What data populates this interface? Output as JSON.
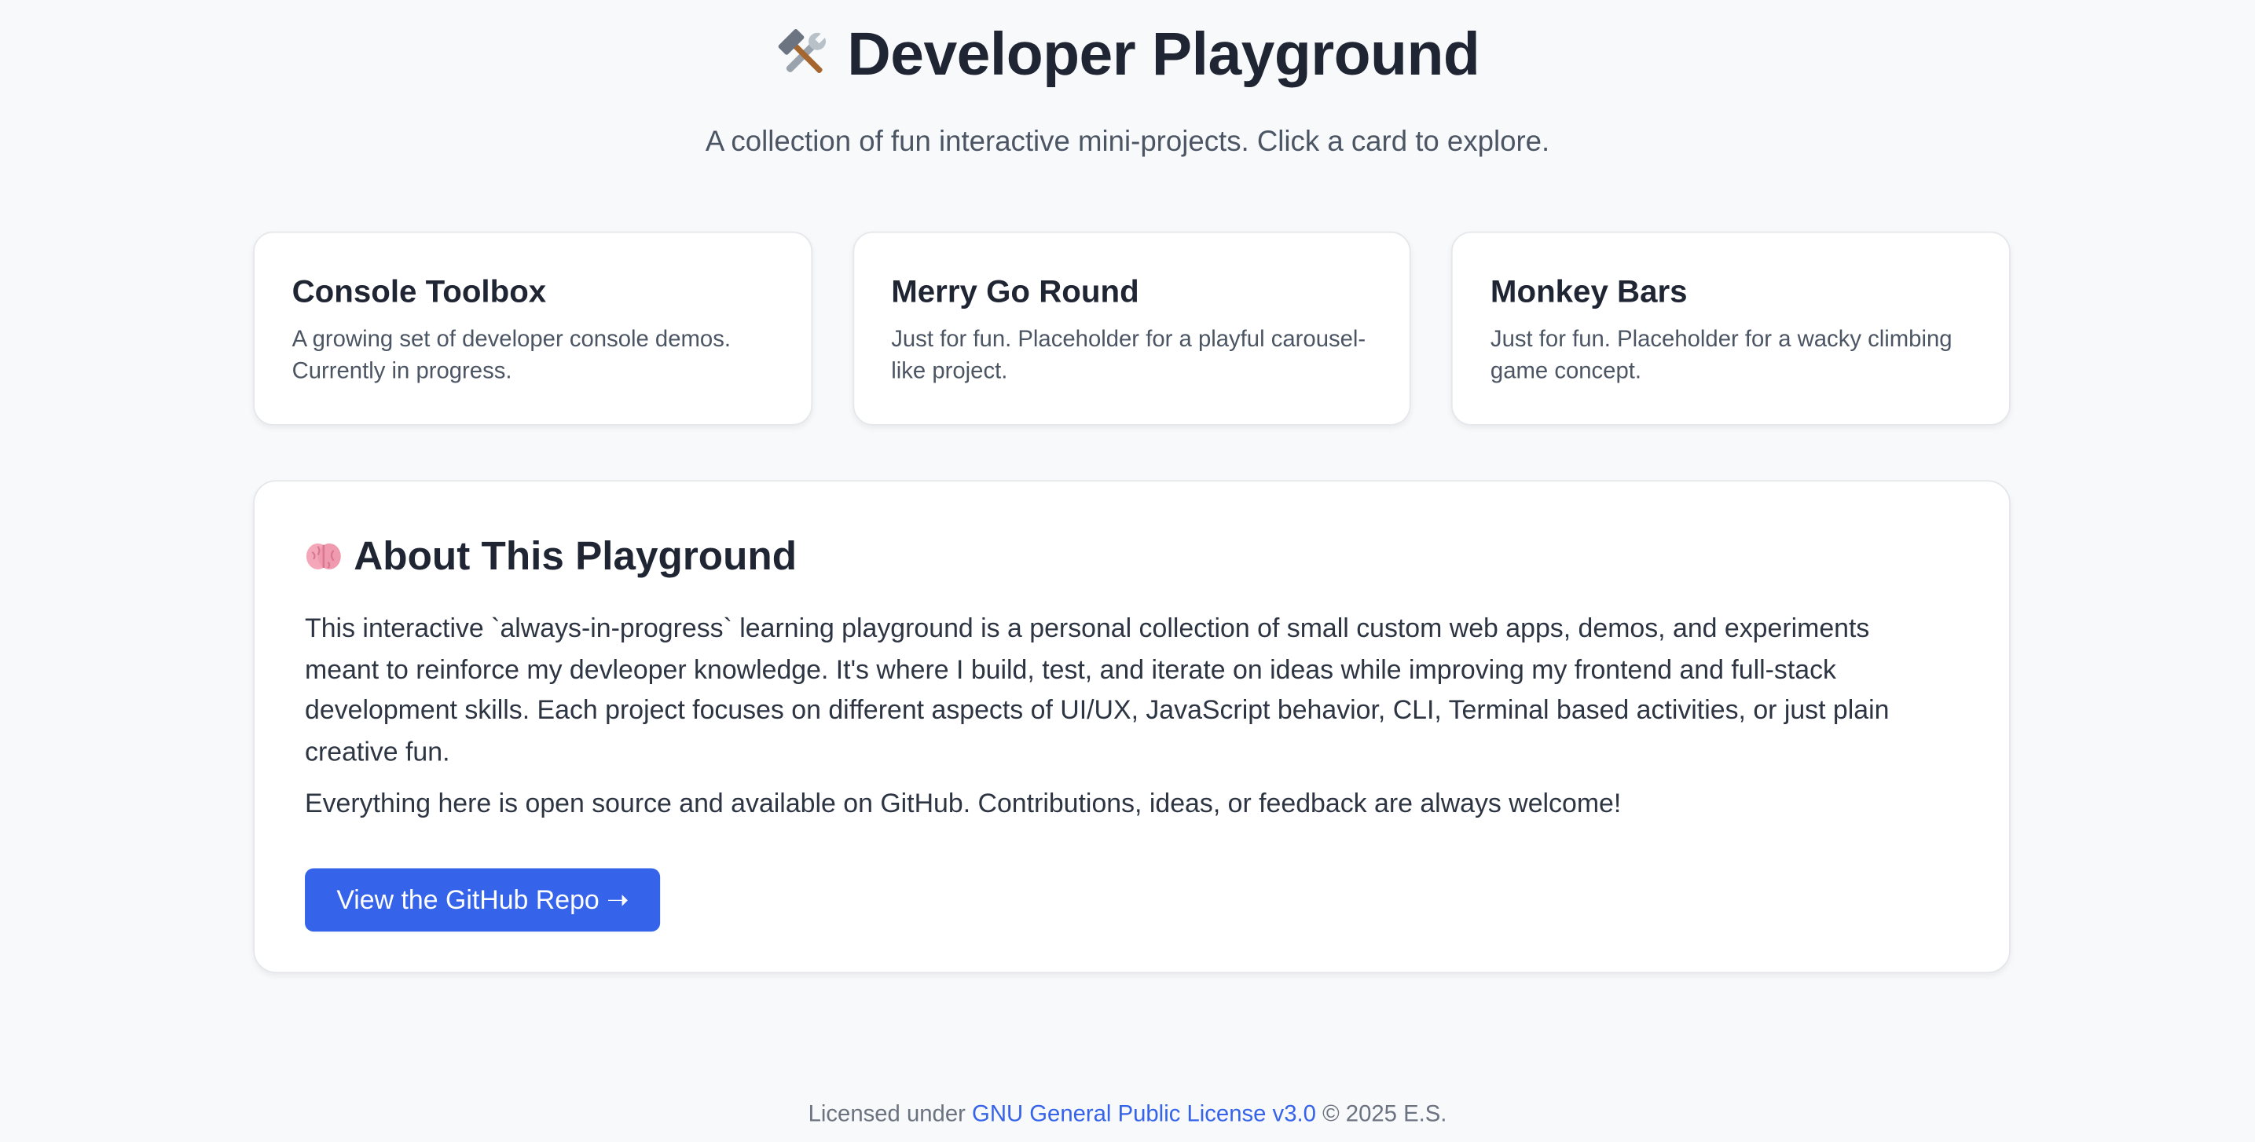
{
  "header": {
    "title": "Developer Playground",
    "title_icon": "hammer-and-wrench-icon",
    "subtitle": "A collection of fun interactive mini-projects. Click a card to explore."
  },
  "cards": [
    {
      "title": "Console Toolbox",
      "description": "A growing set of developer console demos. Currently in progress."
    },
    {
      "title": "Merry Go Round",
      "description": "Just for fun. Placeholder for a playful carousel-like project."
    },
    {
      "title": "Monkey Bars",
      "description": "Just for fun. Placeholder for a wacky climbing game concept."
    }
  ],
  "about": {
    "icon": "brain-icon",
    "title": "About This Playground",
    "paragraph_1": "This interactive `always-in-progress` learning playground is a personal collection of small custom web apps, demos, and experiments meant to reinforce my devleoper knowledge. It's where I build, test, and iterate on ideas while improving my frontend and full-stack development skills. Each project focuses on different aspects of UI/UX, JavaScript behavior, CLI, Terminal based activities, or just plain creative fun.",
    "paragraph_2": "Everything here is open source and available on GitHub. Contributions, ideas, or feedback are always welcome!",
    "button_label": "View the GitHub Repo ➝"
  },
  "footer": {
    "prefix": "Licensed under",
    "license_link": "GNU General Public License v3.0",
    "suffix": "© 2025 E.S."
  },
  "colors": {
    "background": "#f8f9fb",
    "accent": "#3563e9",
    "text_primary": "#1f2533",
    "text_secondary": "#4b5563"
  }
}
